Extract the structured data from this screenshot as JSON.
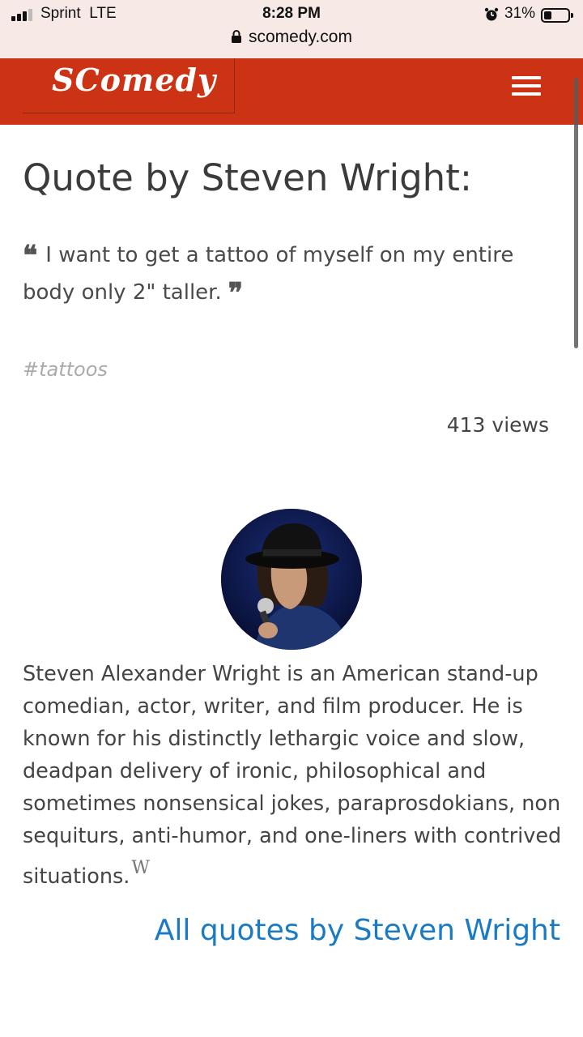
{
  "status_bar": {
    "carrier": "Sprint",
    "network": "LTE",
    "time": "8:28 PM",
    "battery": "31%",
    "battery_level": 0.31,
    "url": "scomedy.com"
  },
  "header": {
    "logo": "SComedy",
    "menu_icon": "hamburger-menu-icon"
  },
  "main": {
    "title": "Quote by Steven Wright:",
    "quote": "I want to get a tattoo of myself on my entire body only 2\" taller.",
    "tag": "#tattoos",
    "views": "413 views",
    "bio": "Steven Alexander Wright is an American stand-up comedian, actor, writer, and film producer. He is known for his distinctly lethargic voice and slow, deadpan delivery of ironic, philosophical and sometimes nonsensical jokes, paraprosdokians, non sequiturs, anti-humor, and one-liners with contrived situations.",
    "wiki_mark": "W",
    "all_quotes_link": "All quotes by Steven Wright"
  },
  "colors": {
    "header_bg": "#cc3314",
    "status_bg": "#f7e9e6",
    "link": "#1a7bc4",
    "tag": "#aaaaaa"
  }
}
